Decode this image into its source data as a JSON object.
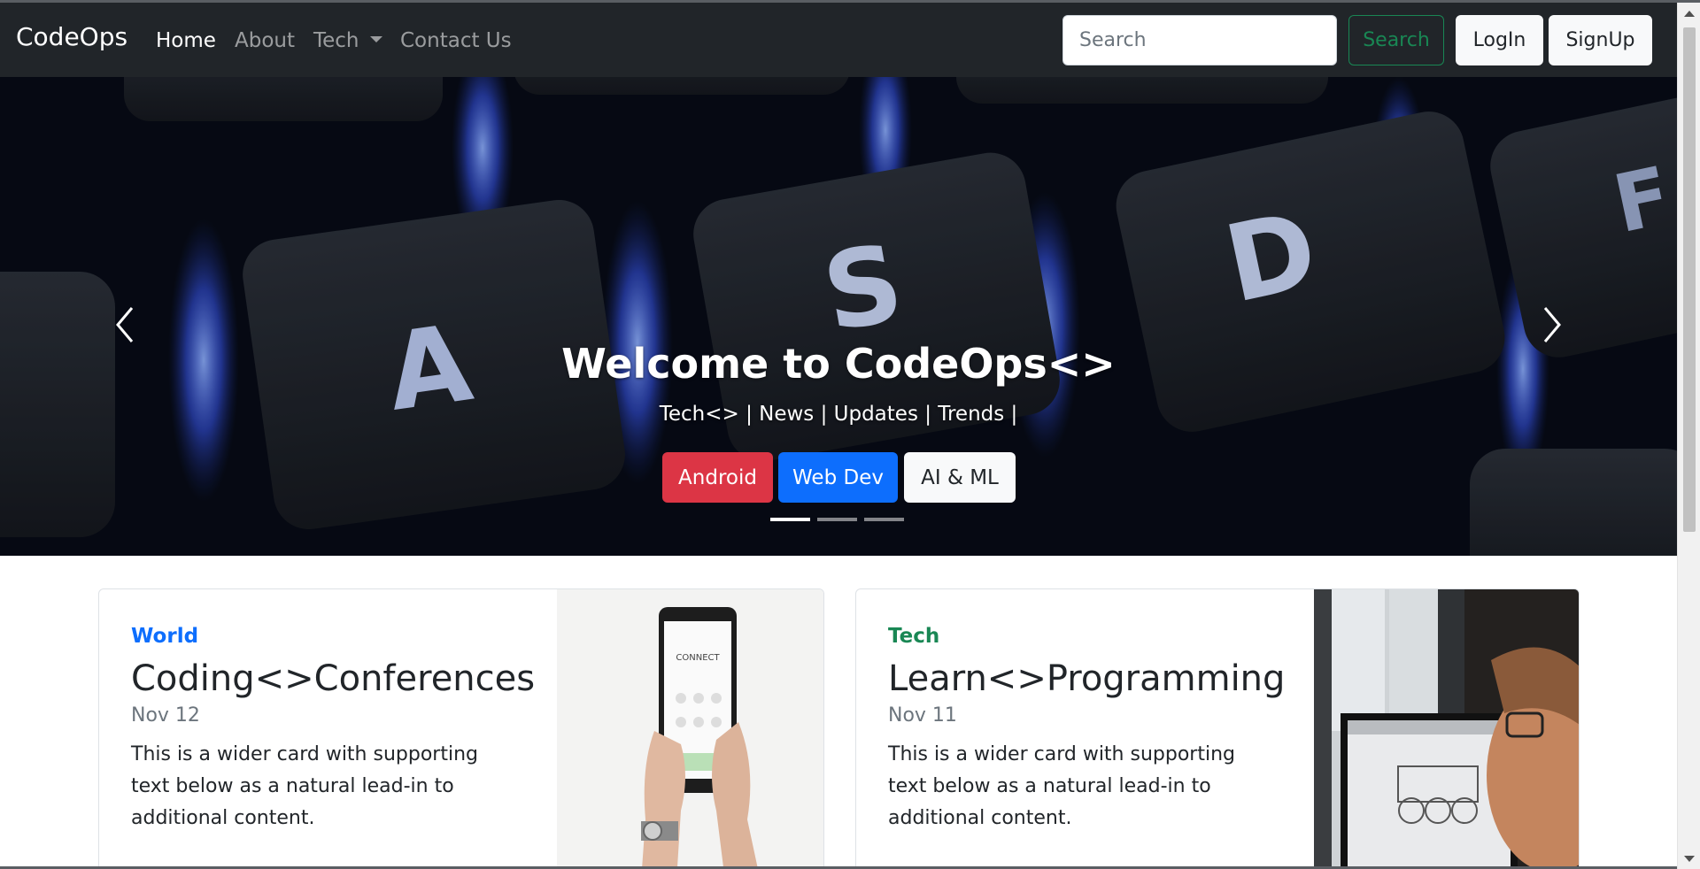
{
  "navbar": {
    "brand": "CodeOps",
    "links": [
      {
        "label": "Home",
        "active": true
      },
      {
        "label": "About",
        "active": false
      },
      {
        "label": "Tech",
        "active": false,
        "dropdown": true
      },
      {
        "label": "Contact Us",
        "active": false
      }
    ],
    "search_placeholder": "Search",
    "search_button": "Search",
    "login_button": "LogIn",
    "signup_button": "SignUp"
  },
  "hero": {
    "title": "Welcome to CodeOps<>",
    "subtitle": "Tech<> | News | Updates | Trends |",
    "buttons": [
      {
        "label": "Android",
        "color": "#dc3545"
      },
      {
        "label": "Web Dev",
        "color": "#0d6efd"
      },
      {
        "label": "AI & ML",
        "color": "#f8f9fa"
      }
    ],
    "slides": 3,
    "active_slide": 1,
    "key_letters": [
      "A",
      "S",
      "D",
      "F"
    ]
  },
  "cards": [
    {
      "category": "World",
      "category_color": "#0d6efd",
      "title": "Coding<>Conferences",
      "date": "Nov 12",
      "text": "This is a wider card with supporting text below as a natural lead-in to additional content.",
      "screen_text": "CONNECT"
    },
    {
      "category": "Tech",
      "category_color": "#198754",
      "title": "Learn<>Programming",
      "date": "Nov 11",
      "text": "This is a wider card with supporting text below as a natural lead-in to additional content."
    }
  ],
  "colors": {
    "navbar_bg": "#212529",
    "accent_green": "#198754",
    "accent_blue": "#0d6efd",
    "accent_red": "#dc3545"
  }
}
